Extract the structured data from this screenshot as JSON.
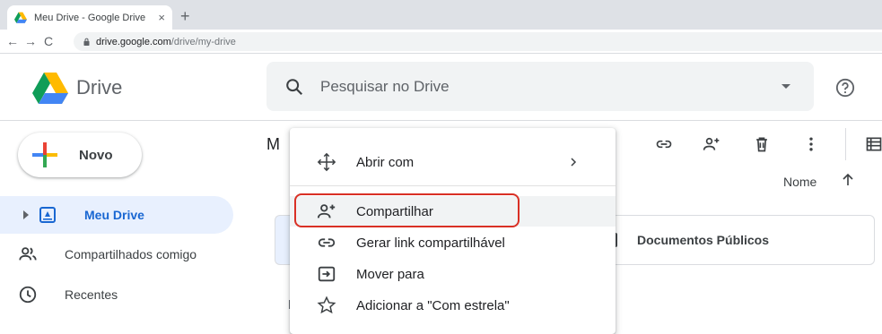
{
  "browser": {
    "tab_title": "Meu Drive - Google Drive",
    "tab_close": "×",
    "new_tab": "+",
    "url_host": "drive.google.com",
    "url_path": "/drive/my-drive",
    "back": "←",
    "forward": "→",
    "reload": "C"
  },
  "header": {
    "app_name": "Drive",
    "search_placeholder": "Pesquisar no Drive"
  },
  "sidebar": {
    "new_label": "Novo",
    "items": [
      {
        "label": "Meu Drive",
        "icon": "my-drive-icon",
        "active": true
      },
      {
        "label": "Compartilhados comigo",
        "icon": "shared-icon",
        "active": false
      },
      {
        "label": "Recentes",
        "icon": "clock-icon",
        "active": false
      }
    ]
  },
  "main": {
    "breadcrumb": "M",
    "sort_label": "Nome",
    "folder_name": "Documentos Públicos"
  },
  "context_menu": {
    "items": [
      {
        "label": "Abrir com",
        "icon": "open-with-icon",
        "has_submenu": true
      },
      {
        "label": "Compartilhar",
        "icon": "share-icon",
        "has_submenu": false
      },
      {
        "label": "Gerar link compartilhável",
        "icon": "link-icon",
        "has_submenu": false
      },
      {
        "label": "Mover para",
        "icon": "move-to-icon",
        "has_submenu": false
      },
      {
        "label": "Adicionar a \"Com estrela\"",
        "icon": "star-icon",
        "has_submenu": false
      }
    ]
  },
  "colors": {
    "accent": "#1967d2",
    "active_bg": "#e8f0fe",
    "highlight_border": "#d93025"
  }
}
